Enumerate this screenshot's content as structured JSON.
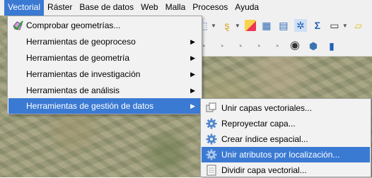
{
  "menubar": {
    "items": [
      {
        "label": "Vectorial",
        "active": true
      },
      {
        "label": "Ráster",
        "active": false
      },
      {
        "label": "Base de datos",
        "active": false
      },
      {
        "label": "Web",
        "active": false
      },
      {
        "label": "Malla",
        "active": false
      },
      {
        "label": "Procesos",
        "active": false
      },
      {
        "label": "Ayuda",
        "active": false
      }
    ]
  },
  "vector_menu": {
    "items": [
      {
        "label": "Comprobar geometrías...",
        "has_submenu": false,
        "highlighted": false,
        "icon": "check-geometry-icon"
      },
      {
        "label": "Herramientas de geoproceso",
        "has_submenu": true,
        "highlighted": false
      },
      {
        "label": "Herramientas de geometría",
        "has_submenu": true,
        "highlighted": false
      },
      {
        "label": "Herramientas de investigación",
        "has_submenu": true,
        "highlighted": false
      },
      {
        "label": "Herramientas de análisis",
        "has_submenu": true,
        "highlighted": false
      },
      {
        "label": "Herramientas de gestión de datos",
        "has_submenu": true,
        "highlighted": true
      }
    ]
  },
  "data_management_submenu": {
    "items": [
      {
        "label": "Unir capas vectoriales...",
        "highlighted": false,
        "icon": "merge-layers-icon"
      },
      {
        "label": "Reproyectar capa...",
        "highlighted": false,
        "icon": "gear-icon"
      },
      {
        "label": "Crear índice espacial...",
        "highlighted": false,
        "icon": "gear-icon"
      },
      {
        "label": "Unir atributos por localización...",
        "highlighted": true,
        "icon": "gear-icon"
      },
      {
        "label": "Dividir capa vectorial...",
        "highlighted": false,
        "icon": "split-layer-icon"
      }
    ]
  },
  "colors": {
    "highlight": "#3b7ad3",
    "menu_bg": "#f2f2f2",
    "menubar_bg": "#f0f0f0"
  }
}
